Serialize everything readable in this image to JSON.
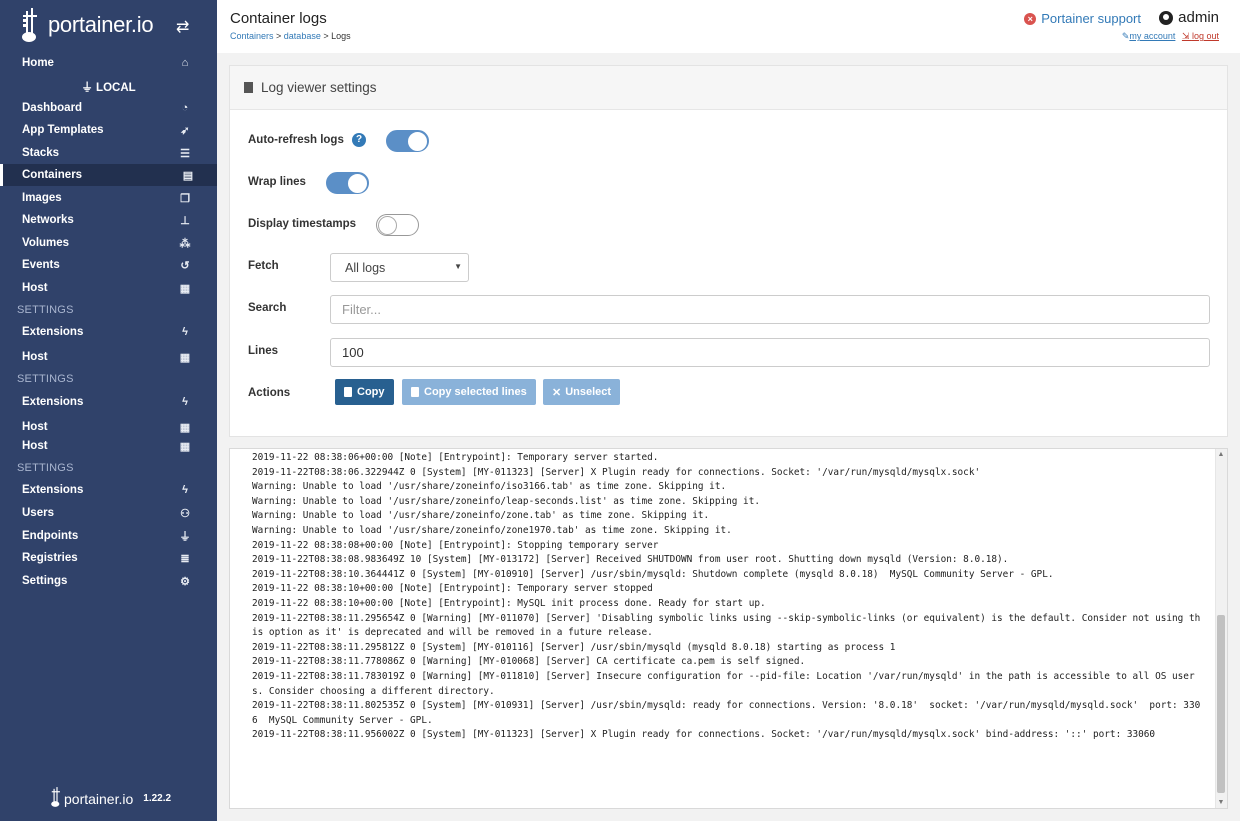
{
  "sidebar": {
    "brand": "portainer.io",
    "env_label": "LOCAL",
    "items": [
      {
        "label": "Home",
        "icon": "home-icon",
        "glyph": "⌂"
      },
      {
        "label": "Dashboard",
        "icon": "tachometer-icon",
        "glyph": "◔"
      },
      {
        "label": "App Templates",
        "icon": "rocket-icon",
        "glyph": "➶"
      },
      {
        "label": "Stacks",
        "icon": "th-list-icon",
        "glyph": "☰"
      },
      {
        "label": "Containers",
        "icon": "server-icon",
        "glyph": "▤"
      },
      {
        "label": "Images",
        "icon": "clone-icon",
        "glyph": "❐"
      },
      {
        "label": "Networks",
        "icon": "sitemap-icon",
        "glyph": "⊥"
      },
      {
        "label": "Volumes",
        "icon": "cubes-icon",
        "glyph": "⁂"
      },
      {
        "label": "Events",
        "icon": "history-icon",
        "glyph": "↺"
      },
      {
        "label": "Host",
        "icon": "th-icon",
        "glyph": "▦"
      },
      {
        "label": "Extensions",
        "icon": "bolt-icon",
        "glyph": "ϟ"
      },
      {
        "label": "Host",
        "icon": "th-icon",
        "glyph": "▦"
      },
      {
        "label": "Extensions",
        "icon": "bolt-icon",
        "glyph": "ϟ"
      },
      {
        "label": "Host",
        "icon": "th-icon",
        "glyph": "▦"
      },
      {
        "label": "Host",
        "icon": "th-icon",
        "glyph": "▦"
      },
      {
        "label": "Extensions",
        "icon": "bolt-icon",
        "glyph": "ϟ"
      },
      {
        "label": "Users",
        "icon": "users-icon",
        "glyph": "⚇"
      },
      {
        "label": "Endpoints",
        "icon": "plug-icon",
        "glyph": "⏚"
      },
      {
        "label": "Registries",
        "icon": "database-icon",
        "glyph": "≣"
      },
      {
        "label": "Settings",
        "icon": "cogs-icon",
        "glyph": "⚙"
      }
    ],
    "sections": [
      "SETTINGS",
      "SETTINGS",
      "SETTINGS"
    ],
    "footer_brand": "portainer.io",
    "version": "1.22.2"
  },
  "header": {
    "title": "Container logs",
    "breadcrumb": {
      "c1": "Containers",
      "sep1": " > ",
      "c2": "database",
      "sep2": " > ",
      "c3": "Logs"
    },
    "support": "Portainer support",
    "user": "admin",
    "my_account": "my account",
    "log_out": "log out"
  },
  "settings": {
    "title": "Log viewer settings",
    "auto_refresh_label": "Auto-refresh logs",
    "auto_refresh_on": true,
    "wrap_lines_label": "Wrap lines",
    "wrap_lines_on": true,
    "timestamps_label": "Display timestamps",
    "timestamps_on": false,
    "fetch_label": "Fetch",
    "fetch_value": "All logs",
    "search_label": "Search",
    "search_placeholder": "Filter...",
    "lines_label": "Lines",
    "lines_value": "100",
    "actions_label": "Actions",
    "copy": "Copy",
    "copy_selected": "Copy selected lines",
    "unselect": "Unselect"
  },
  "colors": {
    "sidebar_bg": "#30426a",
    "primary": "#286090",
    "link": "#337ab7",
    "toggle_on": "#5b8fc7"
  },
  "logs": [
    "2019-11-22 08:38:06+00:00 [Note] [Entrypoint]: Temporary server started.",
    "2019-11-22T08:38:06.322944Z 0 [System] [MY-011323] [Server] X Plugin ready for connections. Socket: '/var/run/mysqld/mysqlx.sock'",
    "Warning: Unable to load '/usr/share/zoneinfo/iso3166.tab' as time zone. Skipping it.",
    "Warning: Unable to load '/usr/share/zoneinfo/leap-seconds.list' as time zone. Skipping it.",
    "Warning: Unable to load '/usr/share/zoneinfo/zone.tab' as time zone. Skipping it.",
    "Warning: Unable to load '/usr/share/zoneinfo/zone1970.tab' as time zone. Skipping it.",
    "2019-11-22 08:38:08+00:00 [Note] [Entrypoint]: Stopping temporary server",
    "2019-11-22T08:38:08.983649Z 10 [System] [MY-013172] [Server] Received SHUTDOWN from user root. Shutting down mysqld (Version: 8.0.18).",
    "2019-11-22T08:38:10.364441Z 0 [System] [MY-010910] [Server] /usr/sbin/mysqld: Shutdown complete (mysqld 8.0.18)  MySQL Community Server - GPL.",
    "2019-11-22 08:38:10+00:00 [Note] [Entrypoint]: Temporary server stopped",
    "2019-11-22 08:38:10+00:00 [Note] [Entrypoint]: MySQL init process done. Ready for start up.",
    "2019-11-22T08:38:11.295654Z 0 [Warning] [MY-011070] [Server] 'Disabling symbolic links using --skip-symbolic-links (or equivalent) is the default. Consider not using this option as it' is deprecated and will be removed in a future release.",
    "2019-11-22T08:38:11.295812Z 0 [System] [MY-010116] [Server] /usr/sbin/mysqld (mysqld 8.0.18) starting as process 1",
    "2019-11-22T08:38:11.778086Z 0 [Warning] [MY-010068] [Server] CA certificate ca.pem is self signed.",
    "2019-11-22T08:38:11.783019Z 0 [Warning] [MY-011810] [Server] Insecure configuration for --pid-file: Location '/var/run/mysqld' in the path is accessible to all OS users. Consider choosing a different directory.",
    "2019-11-22T08:38:11.802535Z 0 [System] [MY-010931] [Server] /usr/sbin/mysqld: ready for connections. Version: '8.0.18'  socket: '/var/run/mysqld/mysqld.sock'  port: 3306  MySQL Community Server - GPL.",
    "2019-11-22T08:38:11.956002Z 0 [System] [MY-011323] [Server] X Plugin ready for connections. Socket: '/var/run/mysqld/mysqlx.sock' bind-address: '::' port: 33060"
  ]
}
